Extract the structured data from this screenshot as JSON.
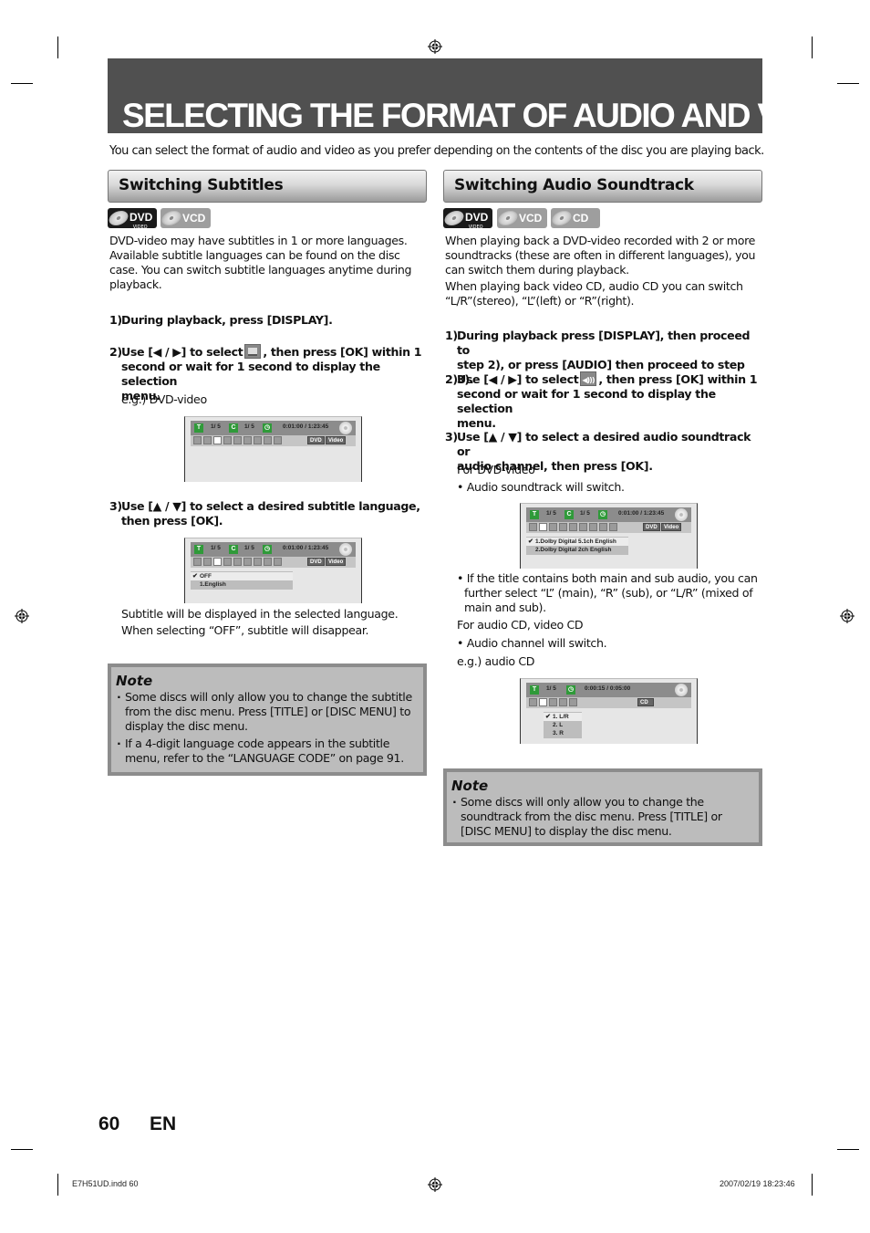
{
  "header": {
    "title": "SELECTING THE FORMAT OF AUDIO AND VIDEO",
    "intro": "You can select the format of audio and video as you prefer depending on the contents of the disc you are playing back."
  },
  "subtitles": {
    "heading": "Switching Subtitles",
    "badges": [
      {
        "label": "DVD",
        "sub": "VIDEO",
        "style": "dark"
      },
      {
        "label": "VCD",
        "style": "light"
      }
    ],
    "description": [
      "DVD-video may have subtitles in 1 or more languages.",
      "Available subtitle languages can be found on the disc",
      "case. You can switch subtitle languages anytime during",
      "playback."
    ],
    "step1": {
      "num": "1)",
      "text": "During playback, press [DISPLAY]."
    },
    "step2": {
      "num": "2)",
      "lines": [
        "Use [◀ / ▶] to select",
        ", then press [OK] within 1",
        "second or wait for 1 second to display the selection",
        "menu."
      ],
      "icon": "subtitle-icon"
    },
    "example_label": "e.g.) DVD-video",
    "osd1": {
      "title_icon": "T",
      "title_val": "1/  5",
      "chapter_icon": "C",
      "chapter_val": "1/  5",
      "time": "0:01:00 / 1:23:45",
      "tag1": "DVD",
      "tag2": "Video"
    },
    "step3": {
      "num": "3)",
      "lines": [
        "Use [▲ / ▼] to select a desired subtitle language,",
        "then press [OK]."
      ]
    },
    "osd2": {
      "title_icon": "T",
      "title_val": "1/  5",
      "chapter_icon": "C",
      "chapter_val": "1/  5",
      "time": "0:01:00 / 1:23:45",
      "tag1": "DVD",
      "tag2": "Video",
      "options": [
        "OFF",
        "1.English"
      ],
      "selected": "OFF"
    },
    "result": [
      "Subtitle will be displayed in the selected language.",
      "When selecting “OFF”, subtitle will disappear."
    ],
    "note": {
      "title": "Note",
      "items": [
        [
          "Some discs will only allow you to change the subtitle",
          "from the disc menu. Press [TITLE] or [DISC MENU] to",
          "display the disc menu."
        ],
        [
          "If a 4-digit language code appears in the subtitle",
          "menu, refer to the “LANGUAGE CODE” on page 91."
        ]
      ]
    }
  },
  "audio": {
    "heading": "Switching Audio Soundtrack",
    "badges": [
      {
        "label": "DVD",
        "sub": "VIDEO",
        "style": "dark"
      },
      {
        "label": "VCD",
        "style": "light"
      },
      {
        "label": "CD",
        "style": "light"
      }
    ],
    "description": [
      "When playing back a DVD-video recorded with 2 or more",
      "soundtracks (these are often in different languages), you",
      "can switch them during playback.",
      "When playing back video CD, audio CD you can switch",
      "“L/R”(stereo), “L”(left) or “R”(right)."
    ],
    "step1": {
      "num": "1)",
      "lines": [
        "During playback press [DISPLAY], then proceed to",
        "step 2), or press [AUDIO] then proceed to step 3)."
      ]
    },
    "step2": {
      "num": "2)",
      "lines": [
        "Use [◀ / ▶] to select",
        ", then press [OK] within 1",
        "second or wait for 1 second to display the selection",
        "menu."
      ],
      "icon": "audio-icon"
    },
    "step3": {
      "num": "3)",
      "lines": [
        "Use [▲ / ▼] to select a desired audio soundtrack or",
        "audio channel, then press [OK]."
      ]
    },
    "for_dvd": "For DVD-video",
    "dvd_bullet": "• Audio soundtrack will switch.",
    "osd1": {
      "title_icon": "T",
      "title_val": "1/  5",
      "chapter_icon": "C",
      "chapter_val": "1/  5",
      "time": "0:01:00 / 1:23:45",
      "tag1": "DVD",
      "tag2": "Video",
      "options": [
        "1.Dolby Digital  5.1ch English",
        "2.Dolby Digital     2ch English"
      ],
      "selected": "1.Dolby Digital  5.1ch English"
    },
    "main_sub_bullet": [
      "• If the title contains both main and sub audio, you can",
      "further select “L” (main), “R” (sub), or “L/R” (mixed of",
      "main and sub)."
    ],
    "for_cd": "For audio CD, video CD",
    "cd_bullet": "• Audio channel will switch.",
    "cd_example": "e.g.) audio CD",
    "osd2": {
      "title_icon": "T",
      "title_val": "1/  5",
      "time": "0:00:15 / 0:05:00",
      "tag1": "CD",
      "options": [
        "1. L/R",
        "2. L",
        "3. R"
      ],
      "selected": "1. L/R"
    },
    "note": {
      "title": "Note",
      "items": [
        [
          "Some discs will only allow you to change the",
          "soundtrack from the disc menu. Press [TITLE] or",
          "[DISC MENU] to display the disc menu."
        ]
      ]
    }
  },
  "footer": {
    "page_number": "60",
    "language": "EN",
    "file": "E7H51UD.indd   60",
    "timestamp": "2007/02/19   18:23:46"
  }
}
